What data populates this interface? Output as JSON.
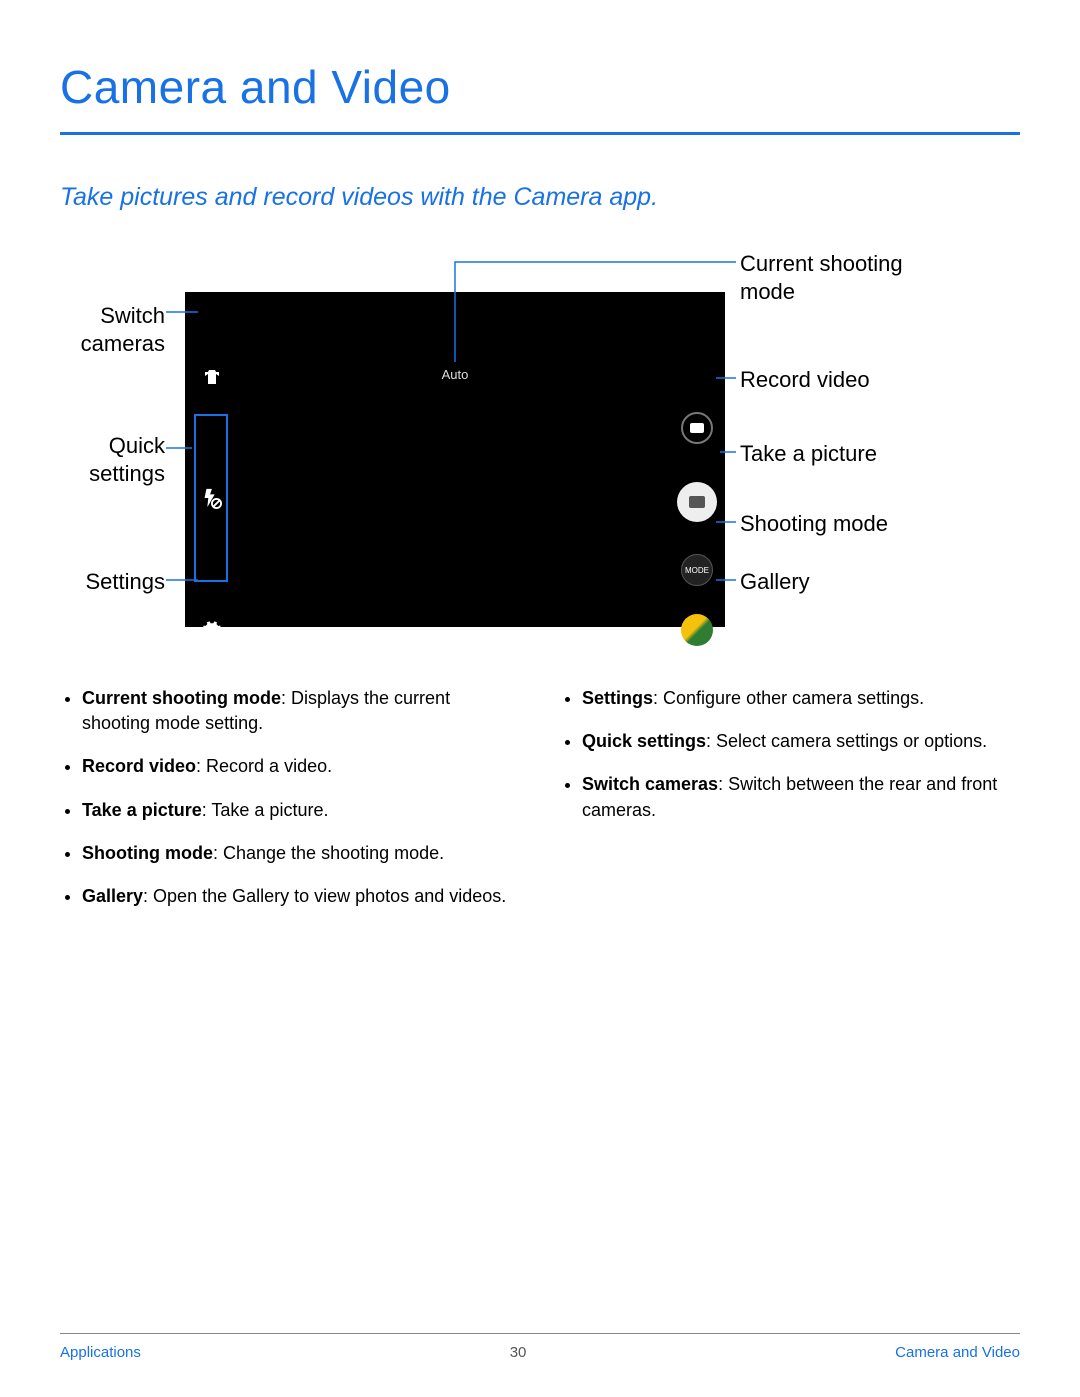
{
  "title": "Camera and Video",
  "subtitle": "Take pictures and record videos with the Camera app.",
  "camera": {
    "mode_label": "Auto",
    "mode_button_text": "MODE"
  },
  "callouts": {
    "left": {
      "switch": "Switch cameras",
      "quick": "Quick settings",
      "settings": "Settings"
    },
    "right": {
      "current": "Current shooting mode",
      "record": "Record video",
      "picture": "Take a picture",
      "shootmode": "Shooting mode",
      "gallery": "Gallery"
    }
  },
  "bullets_left": [
    {
      "term": "Current shooting mode",
      "desc": ": Displays the current shooting mode setting."
    },
    {
      "term": "Record video",
      "desc": ": Record a video."
    },
    {
      "term": "Take a picture",
      "desc": ": Take a picture."
    },
    {
      "term": "Shooting mode",
      "desc": ": Change the shooting mode."
    },
    {
      "term": "Gallery",
      "desc": ": Open the Gallery to view photos and videos."
    }
  ],
  "bullets_right": [
    {
      "term": "Settings",
      "desc": ": Configure other camera settings."
    },
    {
      "term": "Quick settings",
      "desc": ": Select camera settings or options."
    },
    {
      "term": "Switch cameras",
      "desc": ": Switch between the rear and front cameras."
    }
  ],
  "footer": {
    "left": "Applications",
    "page": "30",
    "right": "Camera and Video"
  }
}
